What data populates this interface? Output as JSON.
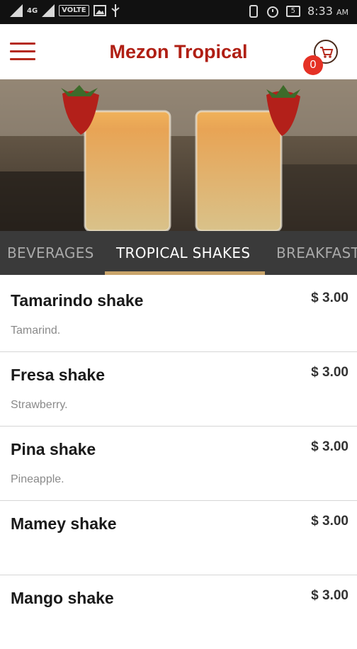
{
  "status_bar": {
    "network": "VOLTE",
    "time": "8:33",
    "ampm": "AM",
    "battery": "5"
  },
  "app": {
    "title": "Mezon Tropical",
    "cart_count": "0"
  },
  "tabs": [
    {
      "label": "BEVERAGES",
      "active": false
    },
    {
      "label": "TROPICAL SHAKES",
      "active": true
    },
    {
      "label": "BREAKFAST",
      "active": false
    }
  ],
  "menu_items": [
    {
      "name": "Tamarindo shake",
      "price": "$ 3.00",
      "description": "Tamarind."
    },
    {
      "name": "Fresa shake",
      "price": "$ 3.00",
      "description": "Strawberry."
    },
    {
      "name": "Pina shake",
      "price": "$ 3.00",
      "description": "Pineapple."
    },
    {
      "name": "Mamey shake",
      "price": "$ 3.00",
      "description": ""
    },
    {
      "name": "Mango shake",
      "price": "$ 3.00",
      "description": ""
    }
  ],
  "colors": {
    "brand_red": "#b01f14",
    "badge_red": "#e53125",
    "tab_bar": "#3a3a3a",
    "tab_indicator": "#c9a46a"
  }
}
